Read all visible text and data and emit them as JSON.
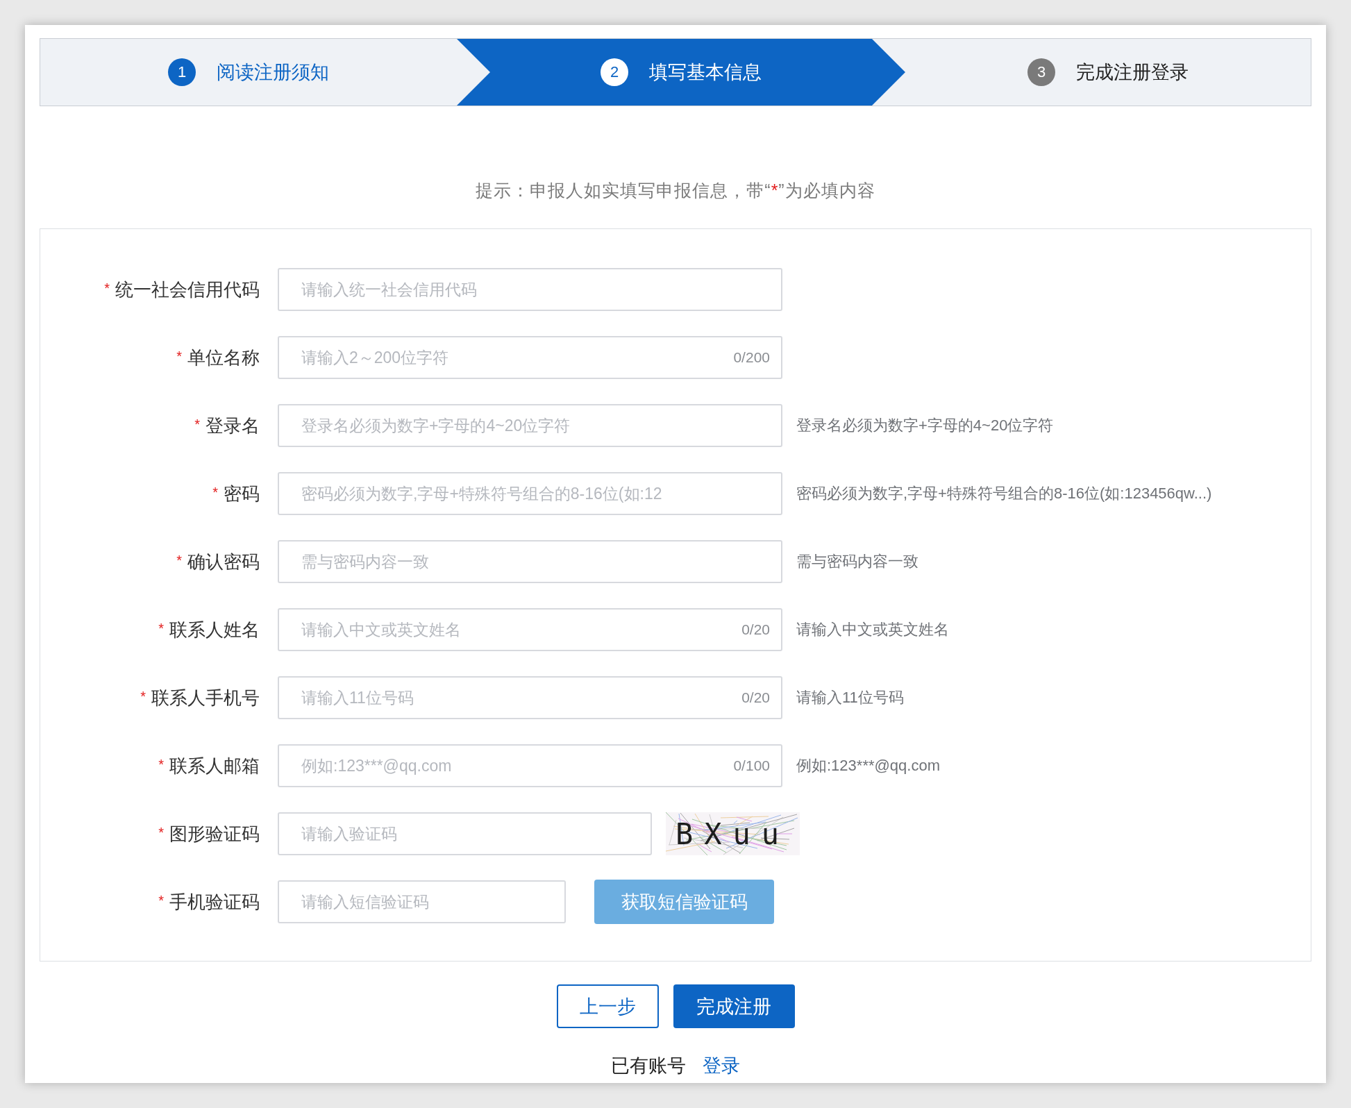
{
  "steps": [
    {
      "number": "1",
      "label": "阅读注册须知",
      "selected": false,
      "completed": true
    },
    {
      "number": "2",
      "label": "填写基本信息",
      "selected": true,
      "completed": false
    },
    {
      "number": "3",
      "label": "完成注册登录",
      "selected": false,
      "completed": false
    }
  ],
  "notice": {
    "before": "提示：申报人如实填写申报信息，带“",
    "mark": "*",
    "after": "”为必填内容"
  },
  "fields": [
    {
      "kind": "text",
      "required_mark": "*",
      "label": "统一社会信用代码",
      "placeholder": "请输入统一社会信用代码"
    },
    {
      "kind": "text",
      "required_mark": "*",
      "label": "单位名称",
      "placeholder": "请输入2～200位字符",
      "counter": "0/200"
    },
    {
      "kind": "text",
      "required_mark": "*",
      "label": "登录名",
      "placeholder": "登录名必须为数字+字母的4~20位字符",
      "hint": "登录名必须为数字+字母的4~20位字符"
    },
    {
      "kind": "text",
      "required_mark": "*",
      "label": "密码",
      "placeholder": "密码必须为数字,字母+特殊符号组合的8-16位(如:12",
      "hint": "密码必须为数字,字母+特殊符号组合的8-16位(如:123456qw...)"
    },
    {
      "kind": "text",
      "required_mark": "*",
      "label": "确认密码",
      "placeholder": "需与密码内容一致",
      "hint": "需与密码内容一致"
    },
    {
      "kind": "text",
      "required_mark": "*",
      "label": "联系人姓名",
      "placeholder": "请输入中文或英文姓名",
      "counter": "0/20",
      "hint": "请输入中文或英文姓名"
    },
    {
      "kind": "text",
      "required_mark": "*",
      "label": "联系人手机号",
      "placeholder": "请输入11位号码",
      "counter": "0/20",
      "hint": "请输入11位号码"
    },
    {
      "kind": "text",
      "required_mark": "*",
      "label": "联系人邮箱",
      "placeholder": "例如:123***@qq.com",
      "counter": "0/100",
      "hint": "例如:123***@qq.com"
    },
    {
      "kind": "captcha",
      "required_mark": "*",
      "label": "图形验证码",
      "placeholder": "请输入验证码",
      "code": "BXuu"
    },
    {
      "kind": "sms",
      "required_mark": "*",
      "label": "手机验证码",
      "placeholder": "请输入短信验证码",
      "button": "获取短信验证码"
    }
  ],
  "buttons": {
    "back": "上一步",
    "submit": "完成注册"
  },
  "footer": {
    "text": "已有账号",
    "link": "登录"
  }
}
